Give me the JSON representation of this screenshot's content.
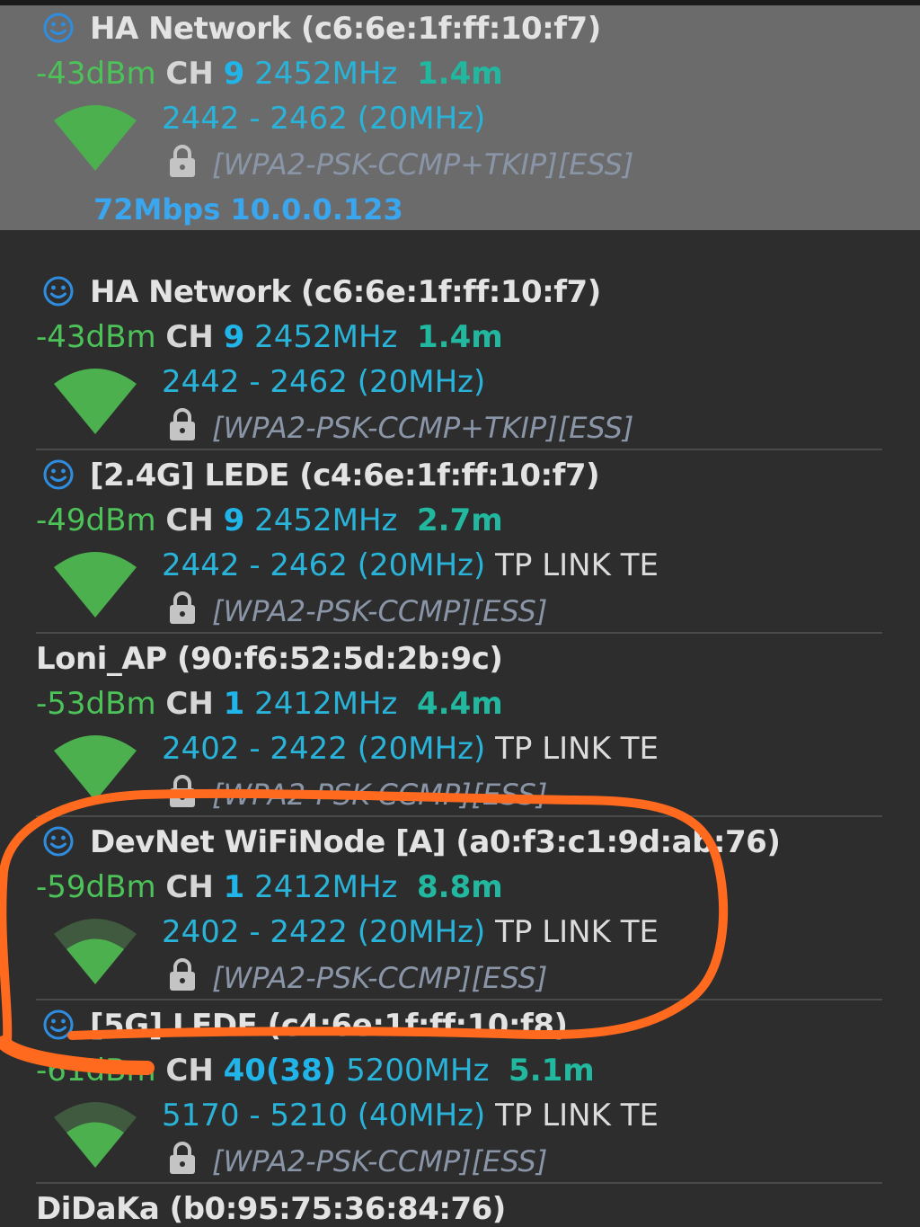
{
  "colors": {
    "selected_bg": "#6b6b6b",
    "signal_dbm": "#4cc259",
    "channel_num": "#20b4e8",
    "frequency": "#2ab3d8",
    "distance": "#22b8a0",
    "security": "#8a96a8",
    "annotation": "#ff6a1f"
  },
  "icons": {
    "smiley": "smiley-face-icon",
    "lock": "lock-icon",
    "signal": "wifi-signal-icon"
  },
  "networks": [
    {
      "name": "HA Network (c6:6e:1f:ff:10:f7)",
      "dbm": "-43dBm",
      "ch_label": "CH",
      "channel": "9",
      "freq": "2452MHz",
      "distance": "1.4m",
      "range": "2442 - 2462 (20MHz)",
      "vendor": "",
      "security": "[WPA2-PSK-CCMP+TKIP][ESS]",
      "link": "72Mbps 10.0.0.123",
      "signal_level": 1.0
    },
    {
      "name": "HA Network (c6:6e:1f:ff:10:f7)",
      "dbm": "-43dBm",
      "ch_label": "CH",
      "channel": "9",
      "freq": "2452MHz",
      "distance": "1.4m",
      "range": "2442 - 2462 (20MHz)",
      "vendor": "",
      "security": "[WPA2-PSK-CCMP+TKIP][ESS]",
      "signal_level": 1.0
    },
    {
      "name": "[2.4G] LEDE (c4:6e:1f:ff:10:f7)",
      "dbm": "-49dBm",
      "ch_label": "CH",
      "channel": "9",
      "freq": "2452MHz",
      "distance": "2.7m",
      "range": "2442 - 2462 (20MHz)",
      "vendor": "TP LINK TE",
      "security": "[WPA2-PSK-CCMP][ESS]",
      "signal_level": 1.0
    },
    {
      "name": "Loni_AP (90:f6:52:5d:2b:9c)",
      "dbm": "-53dBm",
      "ch_label": "CH",
      "channel": "1",
      "freq": "2412MHz",
      "distance": "4.4m",
      "range": "2402 - 2422 (20MHz)",
      "vendor": "TP LINK TE",
      "security": "[WPA2-PSK-CCMP][ESS]",
      "signal_level": 1.0
    },
    {
      "name": "DevNet WiFiNode [A] (a0:f3:c1:9d:ab:76)",
      "dbm": "-59dBm",
      "ch_label": "CH",
      "channel": "1",
      "freq": "2412MHz",
      "distance": "8.8m",
      "range": "2402 - 2422 (20MHz)",
      "vendor": "TP LINK TE",
      "security": "[WPA2-PSK-CCMP][ESS]",
      "signal_level": 0.75
    },
    {
      "name": "[5G] LEDE (c4:6e:1f:ff:10:f8)",
      "dbm": "-61dBm",
      "ch_label": "CH",
      "channel": "40(38)",
      "freq": "5200MHz",
      "distance": "5.1m",
      "range": "5170 - 5210 (40MHz)",
      "vendor": "TP LINK TE",
      "security": "[WPA2-PSK-CCMP][ESS]",
      "signal_level": 0.75
    },
    {
      "name": "DiDaKa (b0:95:75:36:84:76)"
    }
  ]
}
